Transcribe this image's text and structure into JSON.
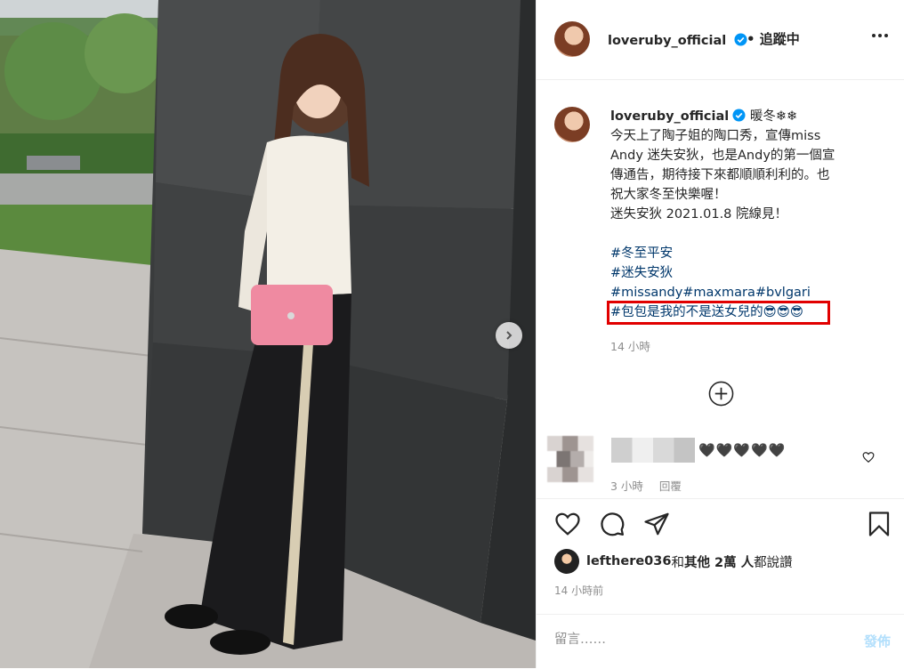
{
  "post": {
    "username": "loveruby_official",
    "follow_status": "• 追蹤中",
    "caption": {
      "title_suffix": "暖冬❄❄",
      "lines": [
        "今天上了陶子姐的陶口秀，宣傳miss",
        "Andy 迷失安狄，也是Andy的第一個宣",
        "傳通告，期待接下來都順順利利的。也",
        "祝大家冬至快樂喔！",
        "迷失安狄 2021.01.8 院線見！"
      ],
      "hashtags": [
        "#冬至平安",
        "#迷失安狄",
        "#missandy#maxmara#bvlgari",
        "#包包是我的不是送女兒的😎😎😎"
      ],
      "time": "14 小時"
    },
    "comment": {
      "text": "🖤🖤🖤🖤🖤",
      "time": "3 小時",
      "reply": "回覆"
    },
    "likes": {
      "liker": "lefthere036",
      "text_and": " 和 ",
      "others": "其他 2萬 人",
      "text_tail": " 都說讚"
    },
    "post_time": "14 小時前",
    "comment_placeholder": "留言……",
    "post_label": "發佈"
  },
  "colors": {
    "highlight_box": "#e10000",
    "hashtag": "#00376b",
    "verified": "#0095f6",
    "post_button_disabled": "#b2dffc"
  },
  "icons": [
    "verified-badge-icon",
    "more-options-icon",
    "chevron-right-icon",
    "plus-circle-icon",
    "heart-icon",
    "comment-icon",
    "share-icon",
    "bookmark-icon"
  ]
}
